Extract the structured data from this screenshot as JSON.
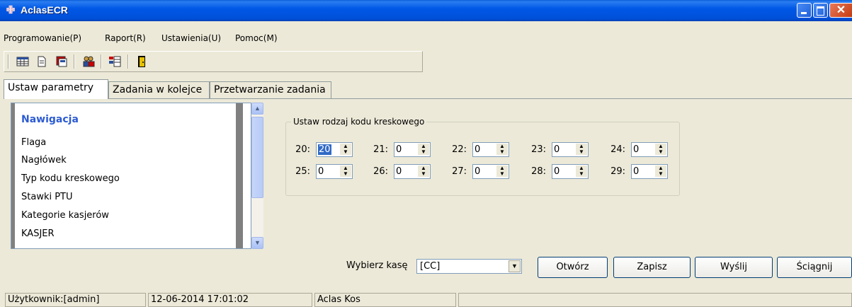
{
  "window": {
    "title": "AclasECR"
  },
  "menu": [
    "Programowanie(P)",
    "Raport(R)",
    "Ustawienia(U)",
    "Pomoc(M)"
  ],
  "toolbar": {
    "icons": [
      "table-icon",
      "document-icon",
      "properties-icon",
      "users-icon",
      "grid-settings-icon",
      "exit-door-icon"
    ]
  },
  "tabs": [
    "Ustaw parametry",
    "Zadania w kolejce",
    "Przetwarzanie zadania"
  ],
  "nav": {
    "title": "Nawigacja",
    "items": [
      "Flaga",
      "Nagłówek",
      "Typ kodu kreskowego",
      "Stawki PTU",
      "Kategorie kasjerów",
      "KASJER"
    ]
  },
  "barcode_group": {
    "legend": "Ustaw rodzaj kodu kreskowego",
    "fields": [
      {
        "label": "20:",
        "value": "20"
      },
      {
        "label": "21:",
        "value": "0"
      },
      {
        "label": "22:",
        "value": "0"
      },
      {
        "label": "23:",
        "value": "0"
      },
      {
        "label": "24:",
        "value": "0"
      },
      {
        "label": "25:",
        "value": "0"
      },
      {
        "label": "26:",
        "value": "0"
      },
      {
        "label": "27:",
        "value": "0"
      },
      {
        "label": "28:",
        "value": "0"
      },
      {
        "label": "29:",
        "value": "0"
      }
    ]
  },
  "controls": {
    "kasa_label": "Wybierz kasę",
    "kasa_value": "[CC]",
    "open": "Otwórz",
    "save": "Zapisz",
    "send": "Wyślij",
    "pull": "Ściągnij"
  },
  "status": {
    "user": "Użytkownik:[admin]",
    "datetime": "12-06-2014 17:01:02",
    "company": "Aclas Kos"
  },
  "colors": {
    "titlebar": "#0058e6",
    "nav_title": "#2c5bd3",
    "selection": "#316ac5",
    "face": "#ece9d8"
  }
}
